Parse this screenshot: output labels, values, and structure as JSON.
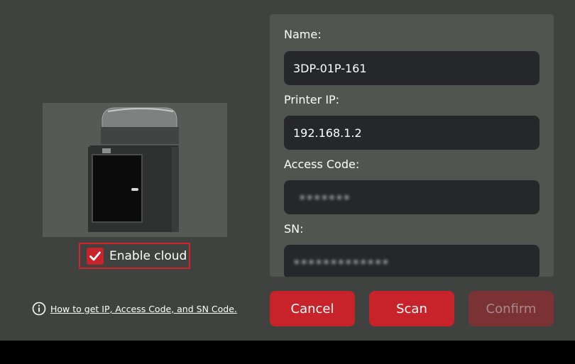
{
  "printer_image": {
    "icon": "printer-with-enclosure-lid"
  },
  "cloud": {
    "label": "Enable cloud",
    "checked": true
  },
  "form": {
    "name_label": "Name:",
    "name_value": "3DP-01P-161",
    "ip_label": "Printer IP:",
    "ip_value": "192.168.1.2",
    "access_label": "Access Code:",
    "access_value": "•••••••",
    "sn_label": "SN:",
    "sn_value": "•••••••••••••"
  },
  "help": {
    "icon": "info-icon",
    "link_text": "How to get IP, Access Code, and SN Code."
  },
  "buttons": {
    "cancel": "Cancel",
    "scan": "Scan",
    "confirm": "Confirm"
  },
  "colors": {
    "accent": "#c8222a",
    "dialog_bg": "#3f423f",
    "panel_bg": "#505550",
    "input_bg": "#25272b"
  }
}
